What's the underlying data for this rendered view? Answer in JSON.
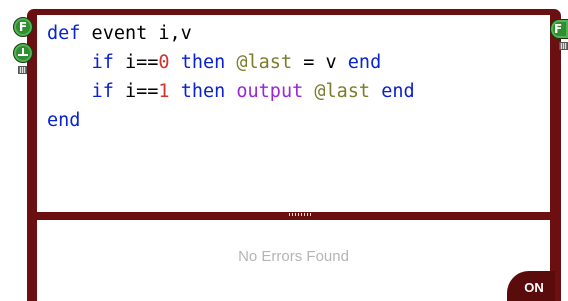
{
  "code": {
    "lines": [
      [
        {
          "t": "kw",
          "v": "def"
        },
        {
          "t": "id",
          "v": " event i,v"
        }
      ],
      [
        {
          "t": "id",
          "v": "    "
        },
        {
          "t": "kw",
          "v": "if"
        },
        {
          "t": "id",
          "v": " i=="
        },
        {
          "t": "num",
          "v": "0"
        },
        {
          "t": "id",
          "v": " "
        },
        {
          "t": "kw",
          "v": "then"
        },
        {
          "t": "id",
          "v": " "
        },
        {
          "t": "ivar",
          "v": "@last"
        },
        {
          "t": "id",
          "v": " = v "
        },
        {
          "t": "kw",
          "v": "end"
        }
      ],
      [
        {
          "t": "id",
          "v": "    "
        },
        {
          "t": "kw",
          "v": "if"
        },
        {
          "t": "id",
          "v": " i=="
        },
        {
          "t": "num",
          "v": "1"
        },
        {
          "t": "id",
          "v": " "
        },
        {
          "t": "kw",
          "v": "then"
        },
        {
          "t": "id",
          "v": " "
        },
        {
          "t": "fn",
          "v": "output"
        },
        {
          "t": "id",
          "v": " "
        },
        {
          "t": "ivar",
          "v": "@last"
        },
        {
          "t": "id",
          "v": " "
        },
        {
          "t": "kw",
          "v": "end"
        }
      ],
      [
        {
          "t": "kw",
          "v": "end"
        }
      ]
    ]
  },
  "console": {
    "status_text": "No Errors Found"
  },
  "toggle": {
    "label": "ON"
  },
  "ports": {
    "left_top_label": "F",
    "right_top_label": "F"
  },
  "icons": {
    "left_top": "f-port-icon",
    "left_bottom": "trigger-port-icon",
    "left_menu": "grid-icon",
    "right_top": "f-port-icon",
    "right_menu": "grid-icon"
  },
  "colors": {
    "frame": "#6b0f10",
    "keyword": "#0a22d0",
    "number": "#d0352c",
    "instance_var": "#7a7d2a",
    "function": "#9a26d8",
    "port_green": "#2f8f2f",
    "status_text": "#b5b5b5"
  }
}
